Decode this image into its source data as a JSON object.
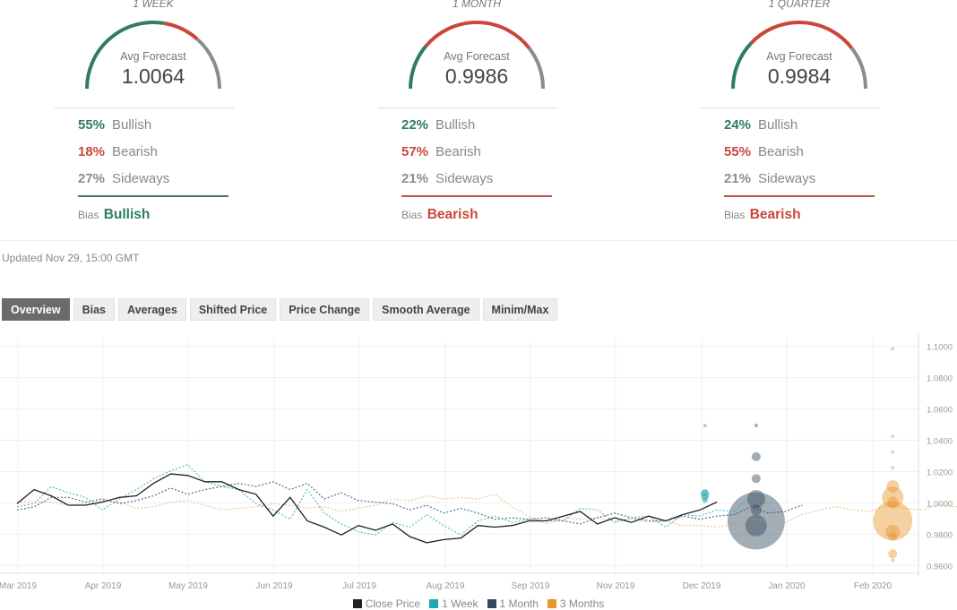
{
  "colors": {
    "bull": "#2e7d62",
    "bear": "#c9473a",
    "side": "#8c8c8c",
    "close": "#222222",
    "week": "#1fa8b0",
    "month": "#34495e",
    "quarter": "#e8962e"
  },
  "panels": [
    {
      "period": "1 WEEK",
      "avg_label": "Avg Forecast",
      "avg_value": "1.0064",
      "bullish_pct": "55%",
      "bullish_label": "Bullish",
      "bearish_pct": "18%",
      "bearish_label": "Bearish",
      "sideways_pct": "27%",
      "sideways_label": "Sideways",
      "bias_label": "Bias",
      "bias_value": "Bullish",
      "bias_type": "bull",
      "shares": [
        0.55,
        0.18,
        0.27
      ]
    },
    {
      "period": "1 MONTH",
      "avg_label": "Avg Forecast",
      "avg_value": "0.9986",
      "bullish_pct": "22%",
      "bullish_label": "Bullish",
      "bearish_pct": "57%",
      "bearish_label": "Bearish",
      "sideways_pct": "21%",
      "sideways_label": "Sideways",
      "bias_label": "Bias",
      "bias_value": "Bearish",
      "bias_type": "bear",
      "shares": [
        0.22,
        0.57,
        0.21
      ]
    },
    {
      "period": "1 QUARTER",
      "avg_label": "Avg Forecast",
      "avg_value": "0.9984",
      "bullish_pct": "24%",
      "bullish_label": "Bullish",
      "bearish_pct": "55%",
      "bearish_label": "Bearish",
      "sideways_pct": "21%",
      "sideways_label": "Sideways",
      "bias_label": "Bias",
      "bias_value": "Bearish",
      "bias_type": "bear",
      "shares": [
        0.24,
        0.55,
        0.21
      ]
    }
  ],
  "updated": "Updated Nov 29, 15:00 GMT",
  "tabs": [
    {
      "label": "Overview",
      "active": true
    },
    {
      "label": "Bias",
      "active": false
    },
    {
      "label": "Averages",
      "active": false
    },
    {
      "label": "Shifted Price",
      "active": false
    },
    {
      "label": "Price Change",
      "active": false
    },
    {
      "label": "Smooth Average",
      "active": false
    },
    {
      "label": "Minim/Max",
      "active": false
    }
  ],
  "chart_data": {
    "type": "line",
    "title": "",
    "xlabel": "",
    "ylabel": "",
    "ylim": [
      0.955,
      1.105
    ],
    "yticks": [
      1.1,
      1.08,
      1.06,
      1.04,
      1.02,
      1.0,
      0.98,
      0.96
    ],
    "ytick_labels": [
      "1.1000",
      "1.0800",
      "1.0600",
      "1.0400",
      "1.0200",
      "1.0000",
      "0.9800",
      "0.9600"
    ],
    "xtick_labels": [
      "Mar 2019",
      "Apr 2019",
      "May 2019",
      "Jun 2019",
      "Jul 2019",
      "Aug 2019",
      "Sep 2019",
      "Nov 2019",
      "Dec 2019",
      "Jan 2020",
      "Feb 2020"
    ],
    "n_periods": 50,
    "grid": true,
    "legend_position": "bottom-center",
    "legend": [
      {
        "name": "Close Price",
        "color": "#222222"
      },
      {
        "name": "1 Week",
        "color": "#1fa8b0"
      },
      {
        "name": "1 Month",
        "color": "#34495e"
      },
      {
        "name": "3 Months",
        "color": "#e8962e"
      }
    ],
    "series": [
      {
        "name": "Close Price",
        "style": "solid",
        "start": 0,
        "values": [
          0.9995,
          1.0085,
          1.0045,
          0.9985,
          0.9985,
          1.0005,
          1.0035,
          1.0045,
          1.0125,
          1.0185,
          1.0175,
          1.0135,
          1.0135,
          1.0085,
          1.0055,
          0.9915,
          1.0035,
          0.9885,
          0.9845,
          0.9795,
          0.9855,
          0.9825,
          0.9865,
          0.9785,
          0.9745,
          0.9765,
          0.9775,
          0.9855,
          0.9845,
          0.9855,
          0.9885,
          0.9885,
          0.9915,
          0.9945,
          0.9865,
          0.9905,
          0.9875,
          0.9915,
          0.9885,
          0.9925,
          0.9955,
          1.0005
        ]
      },
      {
        "name": "1 Week",
        "style": "dotted",
        "start": 0,
        "values": [
          0.9975,
          0.9995,
          1.0105,
          1.0065,
          1.0035,
          0.9955,
          1.0025,
          1.0085,
          1.0155,
          1.0205,
          1.0245,
          1.0135,
          1.0105,
          1.0085,
          0.9995,
          0.9955,
          0.9895,
          1.0085,
          0.9935,
          0.9865,
          0.9815,
          0.9795,
          0.9875,
          0.9845,
          0.9925,
          0.9855,
          0.9795,
          0.9885,
          0.9915,
          0.9875,
          0.9895,
          0.9885,
          0.9885,
          0.9965,
          0.9955,
          0.9875,
          0.9905,
          0.9915,
          0.9845,
          0.9925,
          0.9915,
          0.9955,
          0.9945,
          1.0045
        ]
      },
      {
        "name": "1 Month",
        "style": "dotted",
        "start": 0,
        "values": [
          0.9955,
          0.9975,
          1.0035,
          1.0035,
          1.0005,
          1.0025,
          0.9995,
          1.0015,
          1.0045,
          1.0095,
          1.0055,
          1.0085,
          1.0105,
          1.0125,
          1.0105,
          1.0135,
          1.0085,
          1.0125,
          1.0025,
          1.0065,
          1.0015,
          1.0005,
          0.9995,
          0.9955,
          0.9985,
          0.9935,
          0.9965,
          0.9935,
          0.9895,
          0.9905,
          0.9895,
          0.9905,
          0.9885,
          0.9865,
          0.9905,
          0.9935,
          0.9905,
          0.9885,
          0.9885,
          0.9915,
          0.9895,
          0.9915,
          0.9925,
          0.9975,
          0.9935,
          0.9945,
          0.9985
        ]
      },
      {
        "name": "3 Months",
        "style": "dotted",
        "start": 0,
        "values": [
          1.0005,
          1.0005,
          1.0005,
          0.9985,
          0.9995,
          1.0015,
          1.0005,
          0.9965,
          0.9975,
          1.0005,
          1.0015,
          0.9985,
          0.9955,
          0.9965,
          0.9975,
          0.9995,
          0.9985,
          0.9965,
          0.9975,
          0.9945,
          0.9965,
          0.9985,
          1.0025,
          1.0015,
          1.0045,
          1.0025,
          1.0035,
          1.0025,
          1.0055,
          0.9975,
          0.9915,
          0.9865,
          0.9905,
          0.9895,
          0.9905,
          0.9885,
          0.9895,
          0.9875,
          0.9885,
          0.9855,
          0.9855,
          0.9845,
          0.9865,
          0.9895,
          0.9885,
          0.9875,
          0.9925,
          0.9955,
          0.9975,
          0.9955,
          0.9945,
          0.9985,
          0.9965,
          0.9955,
          0.9985,
          0.9975,
          0.9995
        ]
      }
    ],
    "bubbles": [
      {
        "series": "1 Week",
        "period": 40.3,
        "points": [
          {
            "y": 1.0495,
            "r": 2
          },
          {
            "y": 1.0065,
            "r": 4
          },
          {
            "y": 1.0055,
            "r": 5
          },
          {
            "y": 1.0035,
            "r": 4
          },
          {
            "y": 1.0015,
            "r": 3
          }
        ]
      },
      {
        "series": "1 Month",
        "period": 43.3,
        "points": [
          {
            "y": 1.0495,
            "r": 2
          },
          {
            "y": 1.0295,
            "r": 5
          },
          {
            "y": 1.0155,
            "r": 5
          },
          {
            "y": 1.0025,
            "r": 10
          },
          {
            "y": 0.9955,
            "r": 6
          },
          {
            "y": 0.9885,
            "r": 32
          },
          {
            "y": 0.9855,
            "r": 12
          }
        ]
      },
      {
        "series": "3 Months",
        "period": 51.3,
        "points": [
          {
            "y": 1.0985,
            "r": 2
          },
          {
            "y": 1.0425,
            "r": 2
          },
          {
            "y": 1.0325,
            "r": 2
          },
          {
            "y": 1.0225,
            "r": 2
          },
          {
            "y": 1.0105,
            "r": 7
          },
          {
            "y": 1.0035,
            "r": 12
          },
          {
            "y": 1.0005,
            "r": 6
          },
          {
            "y": 0.9885,
            "r": 22
          },
          {
            "y": 0.9815,
            "r": 8
          },
          {
            "y": 0.9785,
            "r": 5
          },
          {
            "y": 0.9675,
            "r": 5
          },
          {
            "y": 0.9635,
            "r": 2
          }
        ]
      }
    ]
  }
}
